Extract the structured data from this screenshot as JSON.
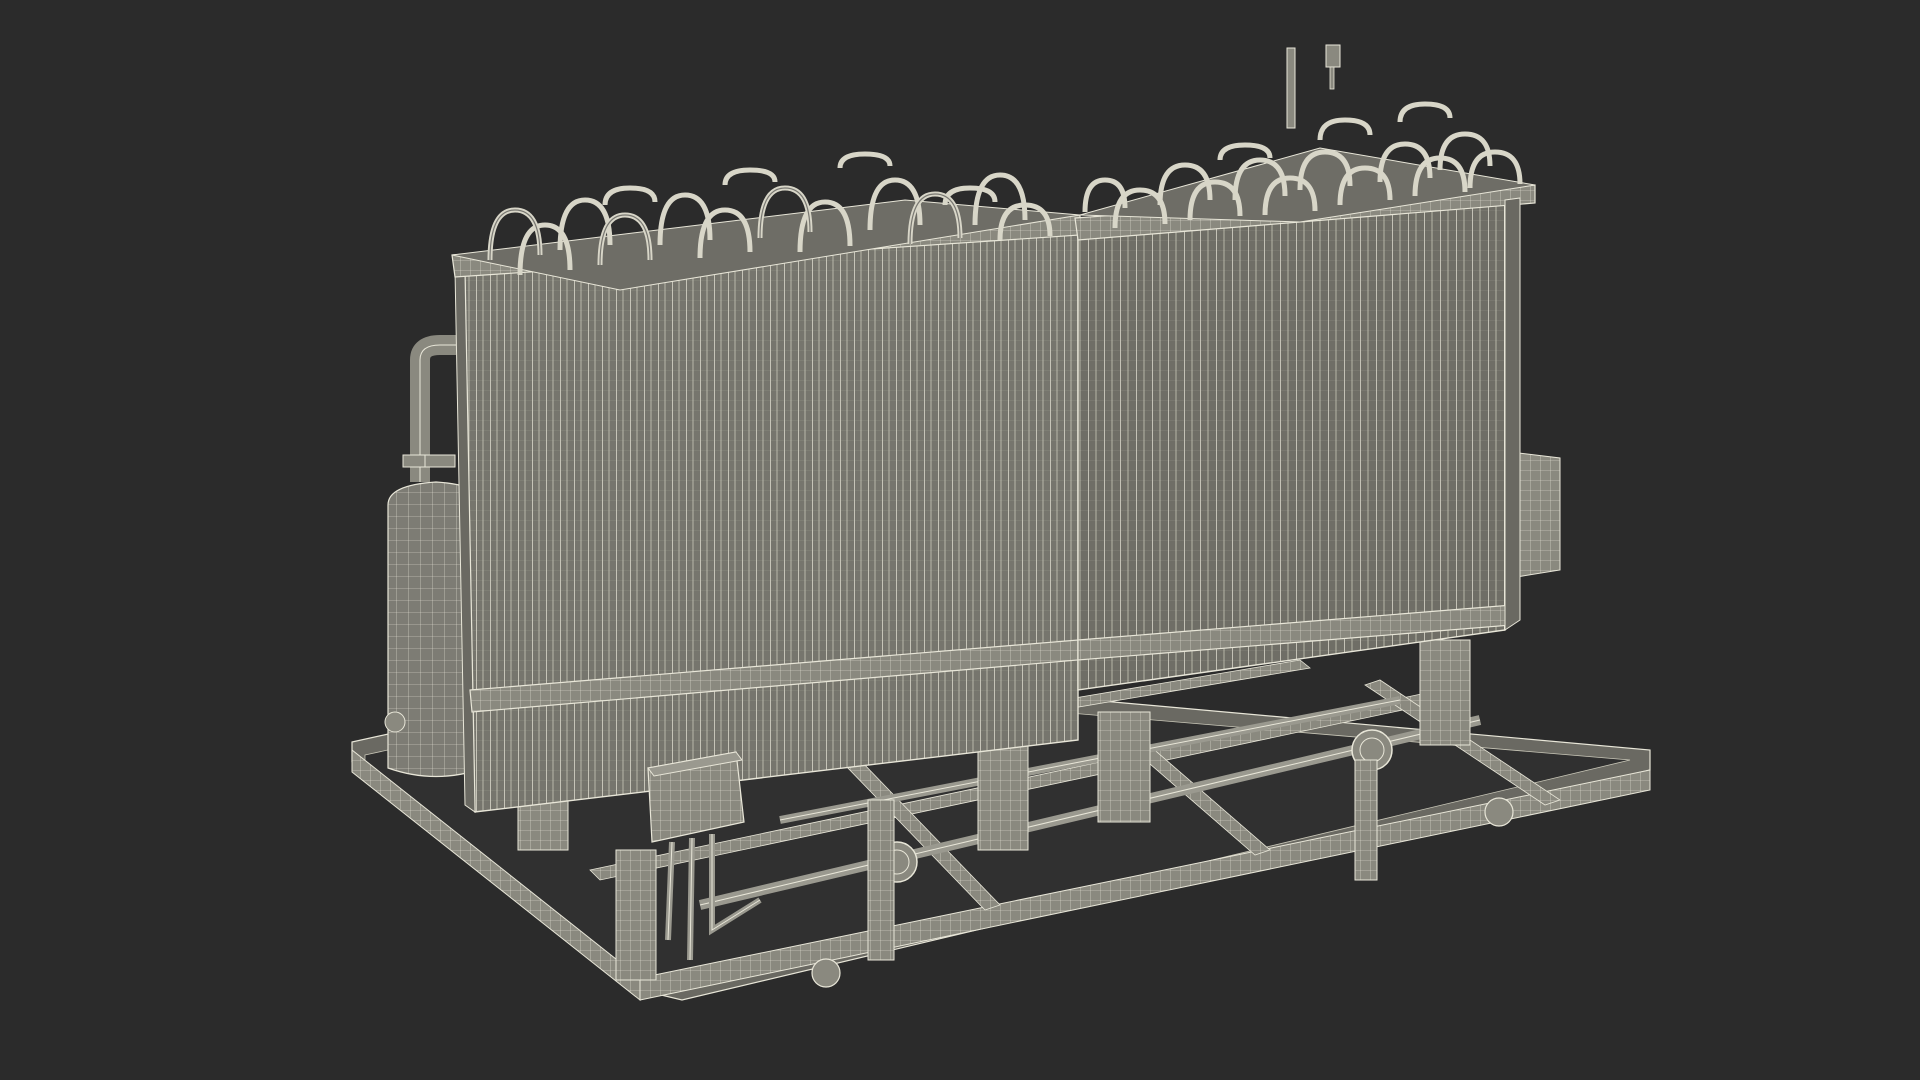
{
  "colors": {
    "background": "#2b2b2b",
    "mesh_fill": "#7b7a72",
    "mesh_fill_dark": "#5f5e58",
    "mesh_fill_light": "#9a998f",
    "wire": "#e8e6d8",
    "wire_dim": "#c9c7b8"
  },
  "icons": {
    "subject": "wireframe-3d-model-icon"
  }
}
